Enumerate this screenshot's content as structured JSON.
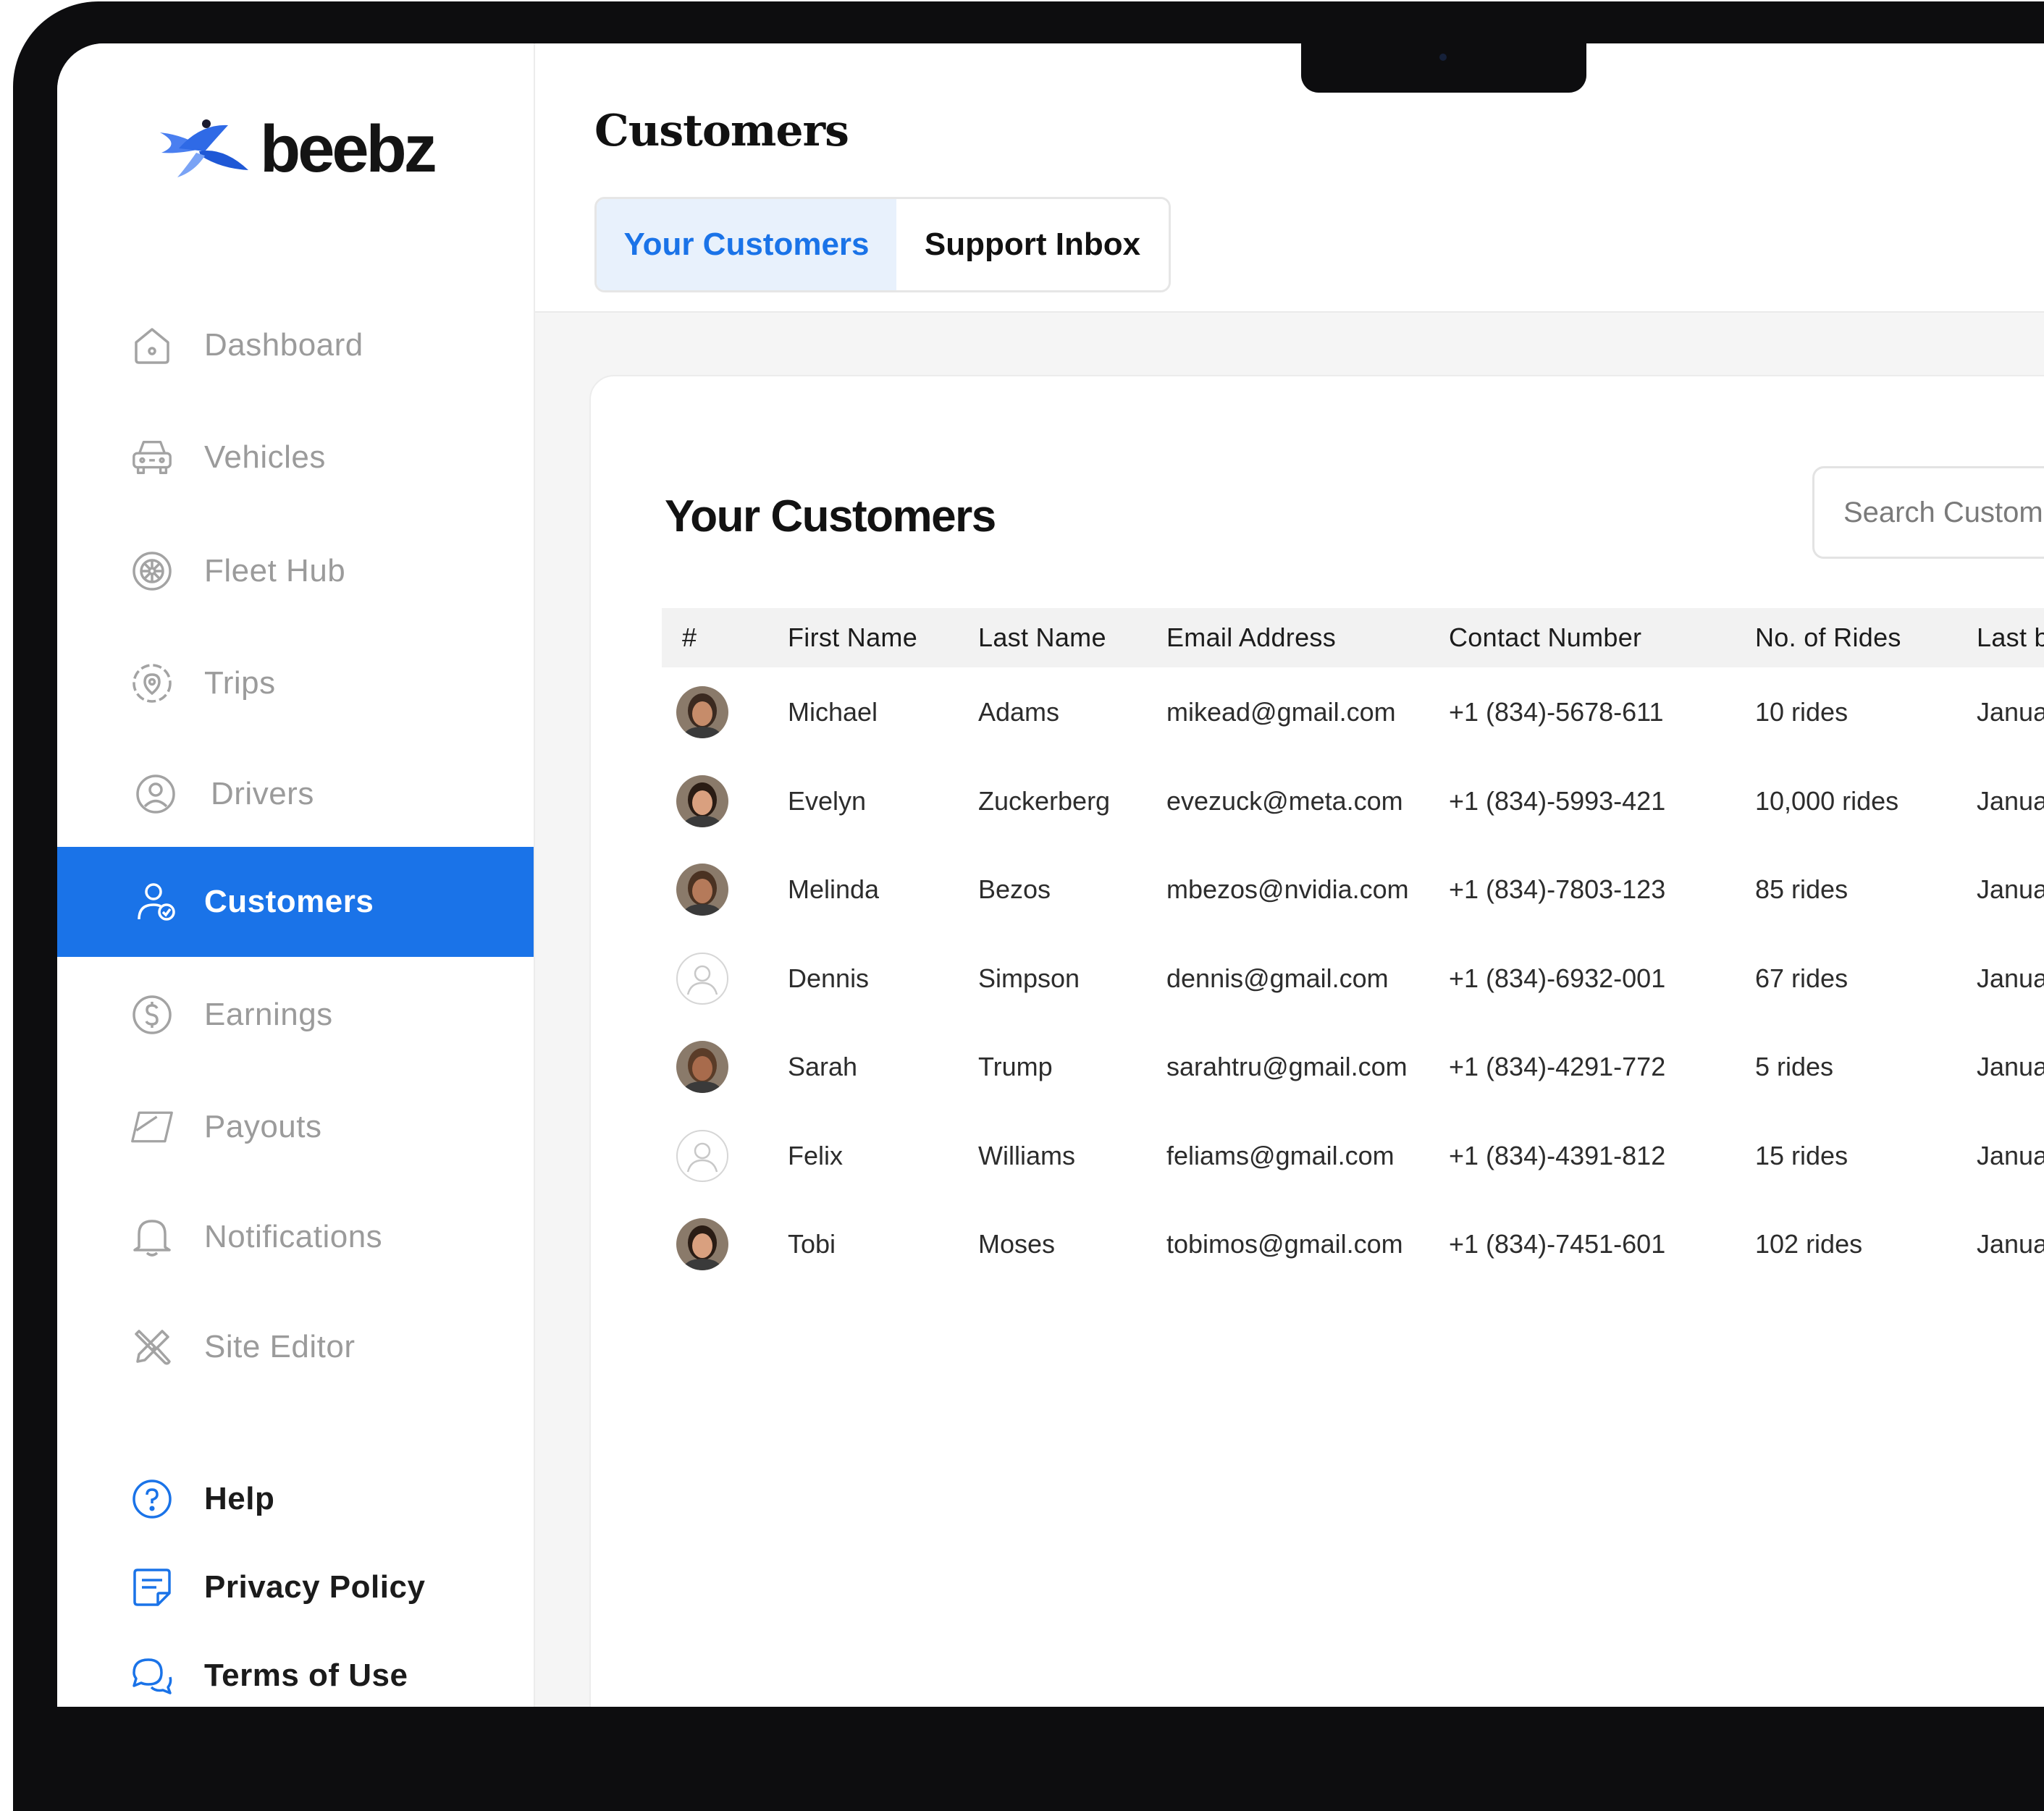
{
  "app": {
    "logo_text": "beebz",
    "page_title": "Customers"
  },
  "sidebar": {
    "items": [
      {
        "label": "Dashboard",
        "icon": "home-icon"
      },
      {
        "label": "Vehicles",
        "icon": "car-icon"
      },
      {
        "label": "Fleet Hub",
        "icon": "wheel-icon"
      },
      {
        "label": "Trips",
        "icon": "map-pin-icon"
      },
      {
        "label": "Drivers",
        "icon": "user-circle-icon"
      },
      {
        "label": "Customers",
        "icon": "user-check-icon",
        "active": true
      },
      {
        "label": "Earnings",
        "icon": "dollar-icon"
      },
      {
        "label": "Payouts",
        "icon": "card-icon"
      },
      {
        "label": "Notifications",
        "icon": "bell-icon"
      },
      {
        "label": "Site Editor",
        "icon": "tools-icon"
      }
    ],
    "bottom": [
      {
        "label": "Help",
        "icon": "help-icon"
      },
      {
        "label": "Privacy Policy",
        "icon": "document-icon"
      },
      {
        "label": "Terms of Use",
        "icon": "chat-icon"
      }
    ]
  },
  "tabs": [
    {
      "label": "Your Customers",
      "active": true
    },
    {
      "label": "Support Inbox",
      "active": false
    }
  ],
  "card": {
    "title": "Your Customers",
    "search_placeholder": "Search Customers"
  },
  "table": {
    "columns": [
      "#",
      "First Name",
      "Last Name",
      "Email Address",
      "Contact Number",
      "No. of Rides",
      "Last b"
    ],
    "rows": [
      {
        "first": "Michael",
        "last": "Adams",
        "email": "mikead@gmail.com",
        "phone": "+1 (834)-5678-611",
        "rides": "10 rides",
        "last_col": "Januar",
        "avatar": "photo"
      },
      {
        "first": "Evelyn",
        "last": "Zuckerberg",
        "email": "evezuck@meta.com",
        "phone": "+1 (834)-5993-421",
        "rides": "10,000 rides",
        "last_col": "Januar",
        "avatar": "photo"
      },
      {
        "first": "Melinda",
        "last": "Bezos",
        "email": "mbezos@nvidia.com",
        "phone": "+1 (834)-7803-123",
        "rides": "85 rides",
        "last_col": "Januar",
        "avatar": "photo"
      },
      {
        "first": "Dennis",
        "last": "Simpson",
        "email": "dennis@gmail.com",
        "phone": "+1 (834)-6932-001",
        "rides": "67 rides",
        "last_col": "Januar",
        "avatar": "placeholder"
      },
      {
        "first": "Sarah",
        "last": "Trump",
        "email": "sarahtru@gmail.com",
        "phone": "+1 (834)-4291-772",
        "rides": "5 rides",
        "last_col": "Januar",
        "avatar": "photo"
      },
      {
        "first": "Felix",
        "last": "Williams",
        "email": "feliams@gmail.com",
        "phone": "+1 (834)-4391-812",
        "rides": "15 rides",
        "last_col": "Januar",
        "avatar": "placeholder"
      },
      {
        "first": "Tobi",
        "last": "Moses",
        "email": "tobimos@gmail.com",
        "phone": "+1 (834)-7451-601",
        "rides": "102 rides",
        "last_col": "Januar",
        "avatar": "photo"
      }
    ]
  },
  "colors": {
    "accent": "#1a73e8",
    "tab_active_bg": "#e8f1fc",
    "nav_inactive": "#9b9b9b"
  }
}
